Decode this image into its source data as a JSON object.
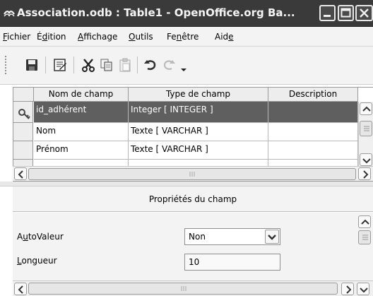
{
  "window": {
    "title": "Association.odb : Table1 - OpenOffice.org Ba...",
    "app_icon": "openoffice-gull-icon"
  },
  "menu": {
    "items": [
      {
        "label_pre": "",
        "label_u": "F",
        "label_post": "ichier"
      },
      {
        "label_pre": "É",
        "label_u": "d",
        "label_post": "ition"
      },
      {
        "label_pre": "",
        "label_u": "A",
        "label_post": "ffichage"
      },
      {
        "label_pre": "",
        "label_u": "O",
        "label_post": "utils"
      },
      {
        "label_pre": "Fe",
        "label_u": "n",
        "label_post": "être"
      },
      {
        "label_pre": "Aid",
        "label_u": "e",
        "label_post": ""
      }
    ]
  },
  "toolbar": {
    "buttons": [
      "save-icon",
      "edit-icon",
      "cut-icon",
      "copy-icon",
      "paste-icon",
      "undo-icon",
      "redo-icon",
      "toolbar-more-icon"
    ]
  },
  "table": {
    "columns": [
      "Nom de champ",
      "Type de champ",
      "Description"
    ],
    "rows": [
      {
        "name": "id_adhérent",
        "type": "Integer [ INTEGER ]",
        "description": "",
        "primary_key": true,
        "selected": true
      },
      {
        "name": "Nom",
        "type": "Texte [ VARCHAR ]",
        "description": "",
        "primary_key": false,
        "selected": false
      },
      {
        "name": "Prénom",
        "type": "Texte [ VARCHAR ]",
        "description": "",
        "primary_key": false,
        "selected": false
      },
      {
        "name": "",
        "type": "",
        "description": "",
        "primary_key": false,
        "selected": false
      }
    ]
  },
  "properties": {
    "title": "Propriétés du champ",
    "autovaleur": {
      "label_pre": "A",
      "label_u": "u",
      "label_post": "toValeur",
      "value": "Non"
    },
    "longueur": {
      "label_pre": "",
      "label_u": "L",
      "label_post": "ongueur",
      "value": "10"
    }
  },
  "colors": {
    "titlebar": "#3a3a3a",
    "selected_row": "#5f5f5f",
    "panel": "#f3f3f3"
  }
}
